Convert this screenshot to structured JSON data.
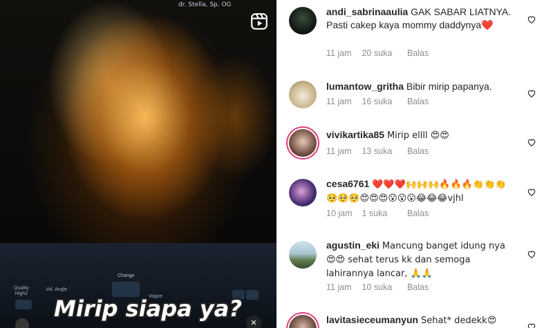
{
  "media": {
    "top_id": "",
    "doctor_label": "dr. Stella, Sp. OG",
    "reels_icon": "reels-icon",
    "panel": {
      "quality_label": "Quality",
      "quality_value": "High2",
      "vol_angle_label": "Vol. Angle",
      "change_label": "Change",
      "volpre_label": "Volpre"
    },
    "caption": "Mirip siapa ya?",
    "mute_icon": "mute-icon"
  },
  "comments": [
    {
      "username": "andi_sabrinaaulia",
      "text": "GAK SABAR LIATNYA. Pasti cakep kaya mommy daddynya❤️",
      "time": "11 jam",
      "likes": "20 suka",
      "reply": "Balas"
    },
    {
      "username": "lumantow_gritha",
      "text": "Bibir mirip papanya.",
      "time": "11 jam",
      "likes": "16 suka",
      "reply": "Balas"
    },
    {
      "username": "vivikartika85",
      "text": "Mirip ellll 😍😍",
      "time": "11 jam",
      "likes": "13 suka",
      "reply": "Balas"
    },
    {
      "username": "cesa6761",
      "text": "❤️❤️❤️🙌🙌🙌🔥🔥🔥👏👏👏🥺🥺🥺😍😍😍😮😮😮😂😂😂vjhl",
      "time": "10 jam",
      "likes": "1 suka",
      "reply": "Balas"
    },
    {
      "username": "agustin_eki",
      "text": "Mancung banget idung nya😍😍 sehat terus kk dan semoga lahirannya lancar, 🙏🙏",
      "time": "11 jam",
      "likes": "10 suka",
      "reply": "Balas"
    },
    {
      "username": "lavitasieceumanyun",
      "text": "Sehat* dedekk😍",
      "time": "",
      "likes": "",
      "reply": ""
    }
  ],
  "icons": {
    "like": "heart-outline-icon"
  }
}
